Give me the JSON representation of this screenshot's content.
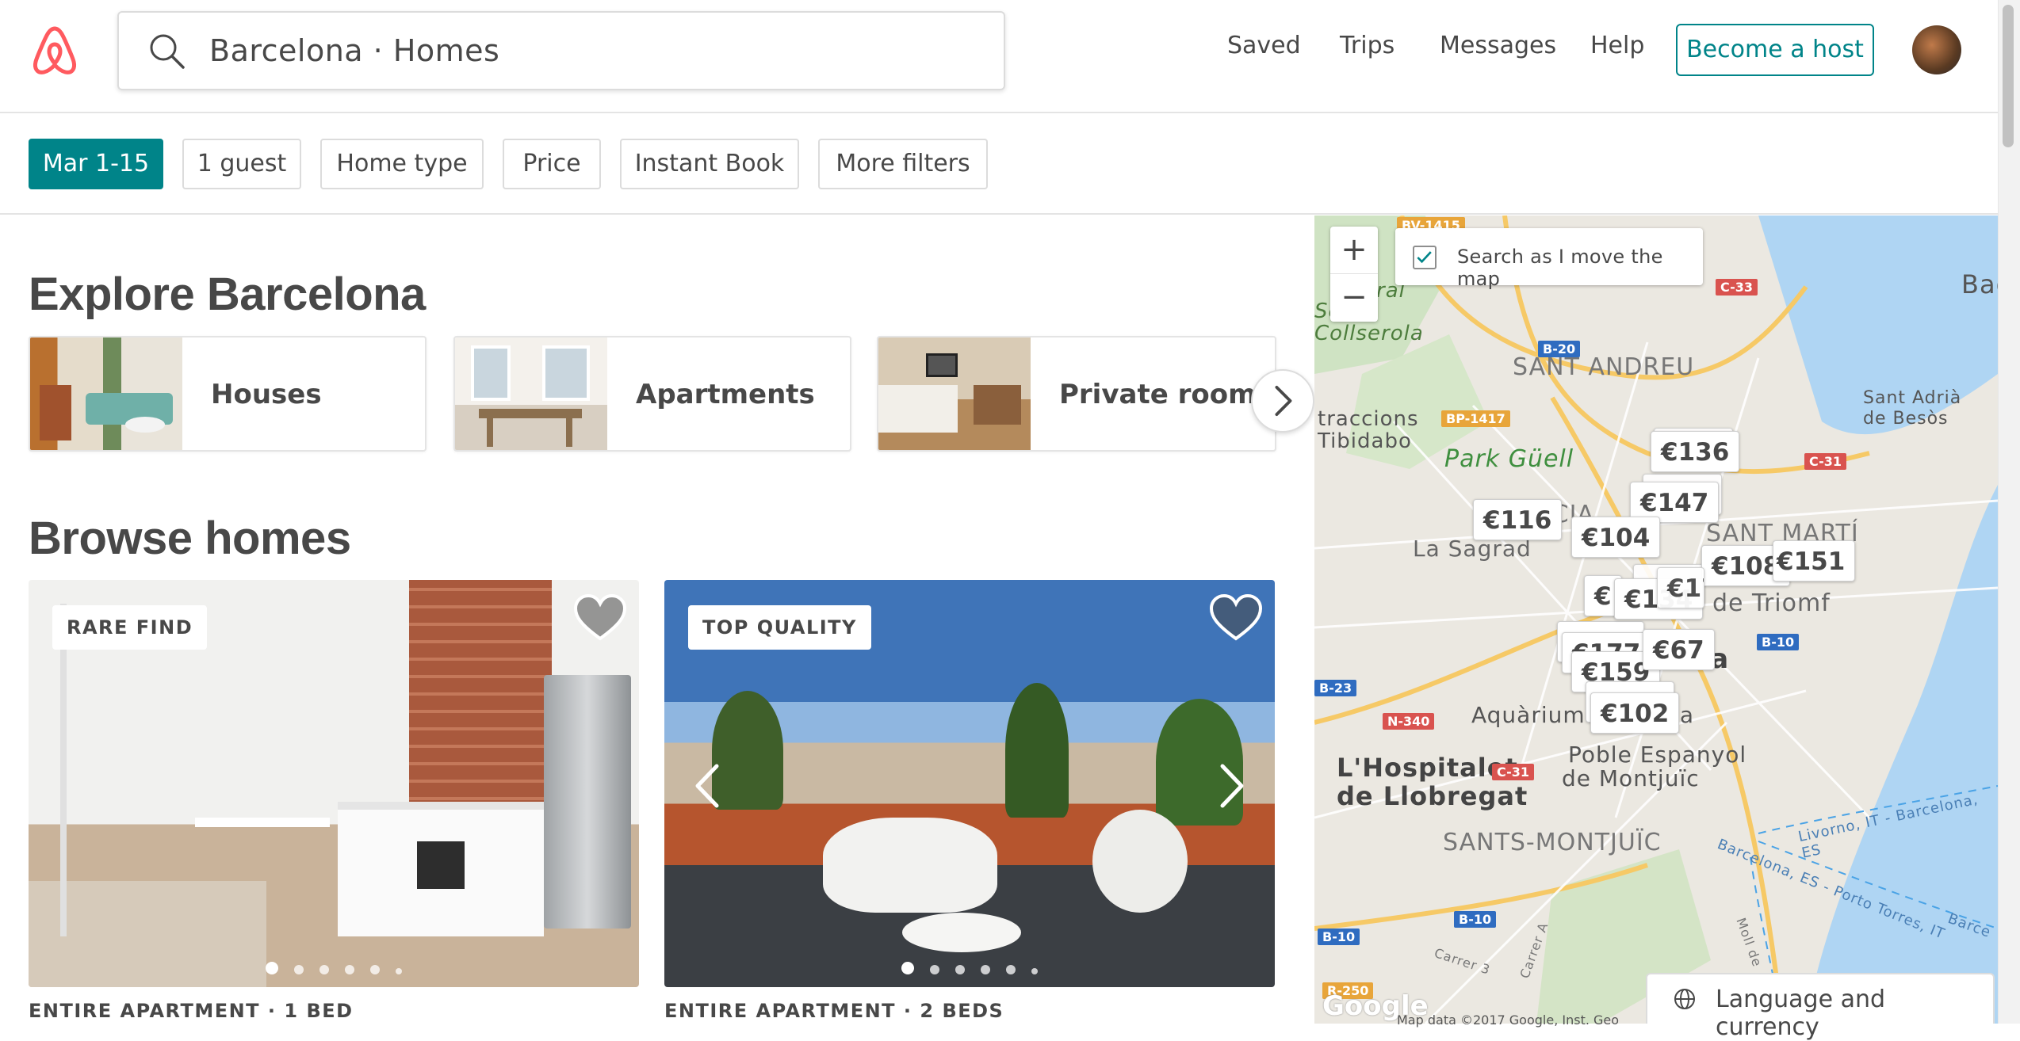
{
  "header": {
    "search_text": "Barcelona · Homes",
    "nav": [
      "Saved",
      "Trips",
      "Messages",
      "Help"
    ],
    "become_host": "Become a host"
  },
  "filters": [
    "Mar 1-15",
    "1 guest",
    "Home type",
    "Price",
    "Instant Book",
    "More filters"
  ],
  "explore": {
    "title": "Explore Barcelona",
    "cards": [
      "Houses",
      "Apartments",
      "Private rooms"
    ]
  },
  "browse": {
    "title": "Browse homes",
    "listings": [
      {
        "badge": "RARE FIND",
        "caption": "ENTIRE APARTMENT · 1 BED"
      },
      {
        "badge": "TOP QUALITY",
        "caption": "ENTIRE APARTMENT · 2 BEDS"
      }
    ]
  },
  "map": {
    "search_as_move": "Search as I move the map",
    "labels": [
      "SANT ANDREU",
      "Park Güell",
      "La Sagrad",
      "SANT MARTÍ",
      "de Triomf",
      "L'Hospitalet",
      "de Llobregat",
      "SANTS-MONTJUÏC",
      "Aquàrium d",
      "Poble Espanyol",
      "de Montjuïc",
      "Sant Adrià",
      "de Besòs",
      "Bada",
      "traccions",
      "Tibidabo",
      "Collserola",
      "ral",
      "Serra",
      "RÀCIA",
      "na",
      "ona"
    ],
    "roads": [
      "BV-1415",
      "C-33",
      "B-20",
      "BP-1417",
      "C-31",
      "B-10",
      "B-23",
      "N-340",
      "C-31",
      "B-10",
      "B-10",
      "R-250"
    ],
    "routes": [
      "Livorno, IT - Barcelona, ES",
      "Barcelona, ES - Porto Torres, IT",
      "Carrer 3",
      "Carrer A",
      "Moll de",
      "Barce"
    ],
    "prices": [
      "€136",
      "€147",
      "€116",
      "€104",
      "€108",
      "€151",
      "€",
      "€134",
      "€177",
      "€67",
      "€159",
      "€144",
      "€102",
      "€177"
    ],
    "attribution": "Map data ©2017 Google, Inst. Geo",
    "google": "Google"
  },
  "footer": {
    "language": "Language and currency"
  }
}
